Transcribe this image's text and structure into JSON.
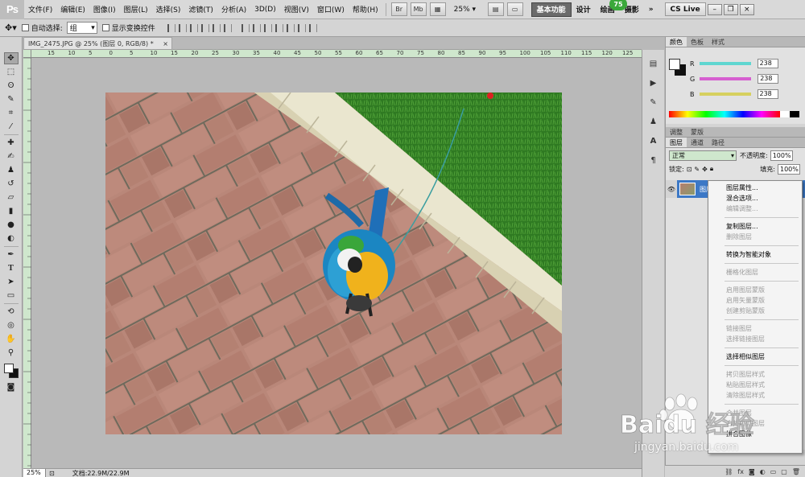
{
  "app": {
    "logo": "Ps",
    "menu": [
      "文件(F)",
      "编辑(E)",
      "图像(I)",
      "图层(L)",
      "选择(S)",
      "滤镜(T)",
      "分析(A)",
      "3D(D)",
      "视图(V)",
      "窗口(W)",
      "帮助(H)"
    ],
    "zoom": "25%",
    "workspaces": [
      "基本功能",
      "设计",
      "绘画",
      "摄影"
    ],
    "more": "»",
    "badge": "75",
    "cs_live": "CS Live"
  },
  "options_bar": {
    "auto_select_label": "自动选择:",
    "auto_select_value": "组",
    "show_transform_label": "显示变换控件"
  },
  "document": {
    "tab_title": "IMG_2475.JPG @ 25% (图层 0, RGB/8) *",
    "close": "×",
    "ruler_numbers": [
      "15",
      "10",
      "5",
      "0",
      "5",
      "10",
      "15",
      "20",
      "25",
      "30",
      "35",
      "40",
      "45",
      "50",
      "55",
      "60",
      "65",
      "70",
      "75",
      "80",
      "85",
      "90",
      "95",
      "100",
      "105",
      "110",
      "115",
      "120",
      "125",
      "130"
    ],
    "status_zoom": "25%",
    "status_doc": "文档:22.9M/22.9M"
  },
  "color_panel": {
    "tabs": [
      "颜色",
      "色板",
      "样式"
    ],
    "r_label": "R",
    "g_label": "G",
    "b_label": "B",
    "r_value": "238",
    "g_value": "238",
    "b_value": "238",
    "r_color": "#5fd6d0",
    "g_color": "#d65fd0",
    "b_color": "#d6d05f"
  },
  "adjust_tabs": [
    "调整",
    "蒙版"
  ],
  "layers_panel": {
    "tabs": [
      "图层",
      "通道",
      "路径"
    ],
    "blend_mode": "正常",
    "opacity_label": "不透明度:",
    "opacity_value": "100%",
    "lock_label": "锁定:",
    "fill_label": "填充:",
    "fill_value": "100%",
    "layer_name": "图层 0"
  },
  "context_menu": {
    "groups": [
      [
        {
          "label": "图层属性...",
          "enabled": true
        },
        {
          "label": "混合选项...",
          "enabled": true
        },
        {
          "label": "编辑调整...",
          "enabled": false
        }
      ],
      [
        {
          "label": "复制图层...",
          "enabled": true
        },
        {
          "label": "删除图层",
          "enabled": false
        }
      ],
      [
        {
          "label": "转换为智能对象",
          "enabled": true
        }
      ],
      [
        {
          "label": "栅格化图层",
          "enabled": false
        }
      ],
      [
        {
          "label": "启用图层蒙版",
          "enabled": false
        },
        {
          "label": "启用矢量蒙版",
          "enabled": false
        },
        {
          "label": "创建剪贴蒙版",
          "enabled": false
        }
      ],
      [
        {
          "label": "链接图层",
          "enabled": false
        },
        {
          "label": "选择链接图层",
          "enabled": false
        }
      ],
      [
        {
          "label": "选择相似图层",
          "enabled": true
        }
      ],
      [
        {
          "label": "拷贝图层样式",
          "enabled": false
        },
        {
          "label": "粘贴图层样式",
          "enabled": false
        },
        {
          "label": "清除图层样式",
          "enabled": false
        }
      ],
      [
        {
          "label": "合并图层",
          "enabled": false
        },
        {
          "label": "合并可见图层",
          "enabled": false
        },
        {
          "label": "拼合图像",
          "enabled": true
        }
      ]
    ]
  },
  "watermark": {
    "brand": "Baidu 经验",
    "url": "jingyan.baidu.com"
  }
}
